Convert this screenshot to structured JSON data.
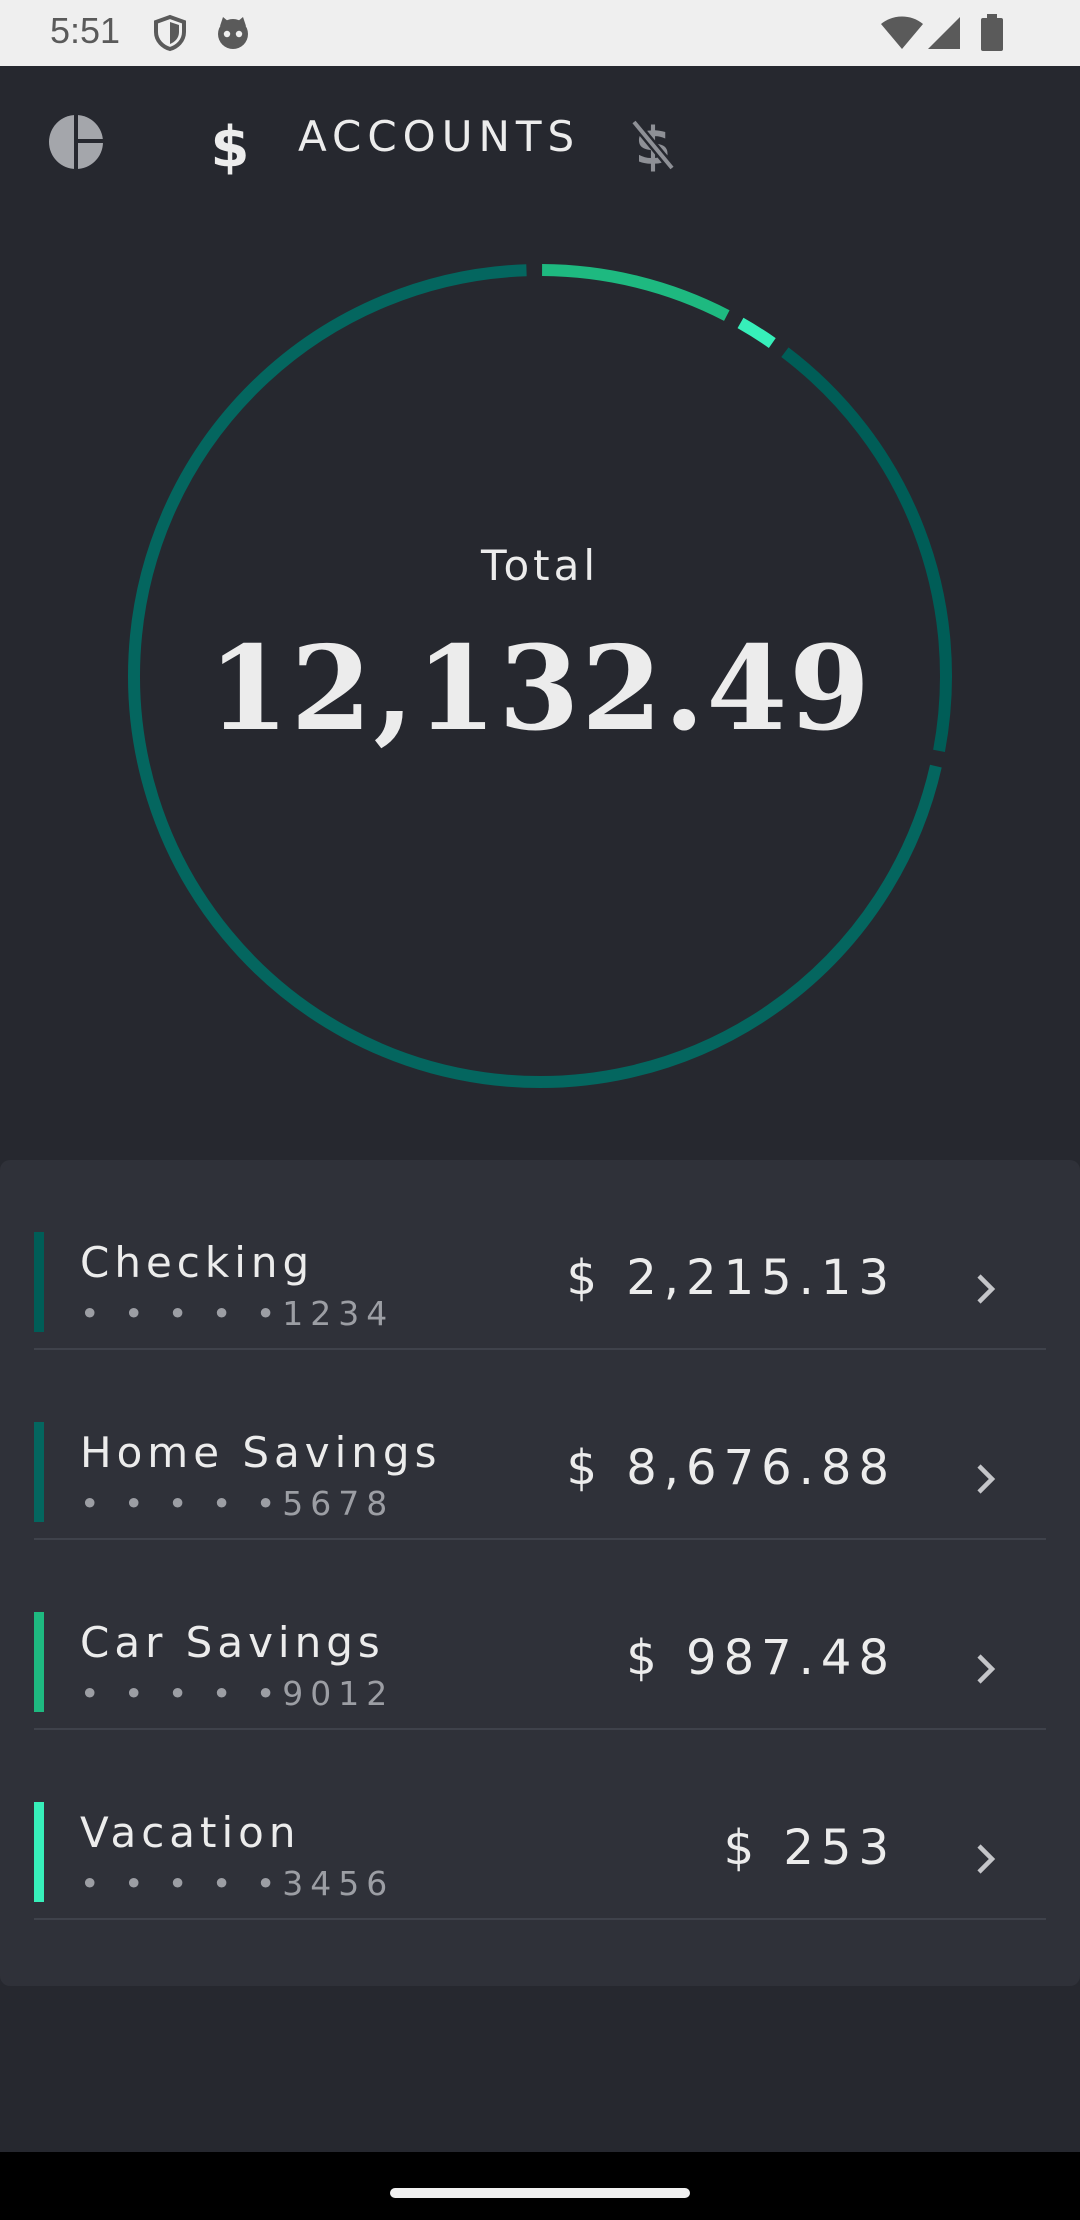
{
  "status_bar": {
    "time": "5:51",
    "icons": [
      "shield-icon",
      "cat-face-icon",
      "wifi-icon",
      "signal-icon",
      "battery-icon"
    ]
  },
  "top_bar": {
    "tabs": [
      {
        "icon": "pie-chart-icon",
        "label": ""
      },
      {
        "icon": "dollar-icon",
        "label": "ACCOUNTS",
        "selected": true
      },
      {
        "icon": "no-dollar-icon",
        "label": ""
      }
    ]
  },
  "summary": {
    "label": "Total",
    "value": "12,132.49",
    "segments": [
      {
        "name": "Checking",
        "value": 2215.13,
        "color": "#005d57"
      },
      {
        "name": "Home Savings",
        "value": 8676.88,
        "color": "#04665f"
      },
      {
        "name": "Car Savings",
        "value": 987.48,
        "color": "#1eb980"
      },
      {
        "name": "Vacation",
        "value": 253,
        "color": "#37efba"
      }
    ]
  },
  "accounts": [
    {
      "name": "Checking",
      "number": "• • • • •1234",
      "amount": "$ 2,215.13",
      "color": "#005d57"
    },
    {
      "name": "Home Savings",
      "number": "• • • • •5678",
      "amount": "$ 8,676.88",
      "color": "#04665f"
    },
    {
      "name": "Car Savings",
      "number": "• • • • •9012",
      "amount": "$ 987.48",
      "color": "#1eb980"
    },
    {
      "name": "Vacation",
      "number": "• • • • •3456",
      "amount": "$ 253",
      "color": "#37efba"
    }
  ]
}
